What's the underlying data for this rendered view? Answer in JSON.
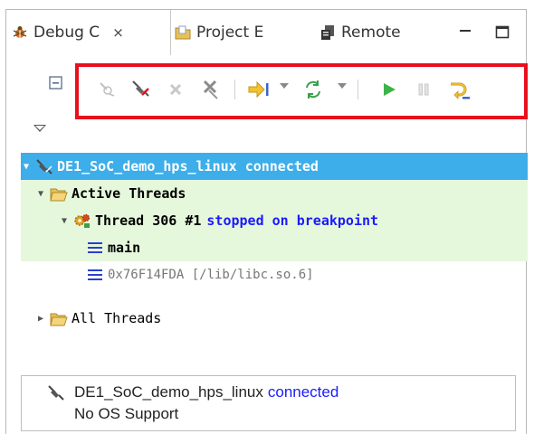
{
  "tabs": [
    {
      "label": "Debug C",
      "icon": "debug-bug-icon",
      "active": true
    },
    {
      "label": "Project E",
      "icon": "project-folder-icon",
      "active": false
    },
    {
      "label": "Remote",
      "icon": "remote-systems-icon",
      "active": false
    }
  ],
  "toolbar": {
    "buttons": [
      "remove-all-terminated-icon",
      "connect-icon",
      "terminate-icon",
      "disconnect-icon",
      "step-to-icon",
      "refresh-icon",
      "resume-icon",
      "suspend-icon",
      "step-over-icon"
    ]
  },
  "tree": {
    "connection": {
      "name": "DE1_SoC_demo_hps_linux",
      "status": "connected"
    },
    "active_threads": "Active Threads",
    "thread": {
      "label": "Thread 306 #1",
      "status": "stopped on breakpoint"
    },
    "frames": [
      "main",
      "0x76F14FDA [/lib/libc.so.6]"
    ],
    "all_threads": "All Threads"
  },
  "details": {
    "name": "DE1_SoC_demo_hps_linux",
    "status": "connected",
    "os_support": "No OS Support"
  },
  "colors": {
    "highlight": "#e8101c",
    "selection": "#3daee9",
    "thread_bg": "#e6f8dc",
    "link_blue": "#1a1aff"
  }
}
